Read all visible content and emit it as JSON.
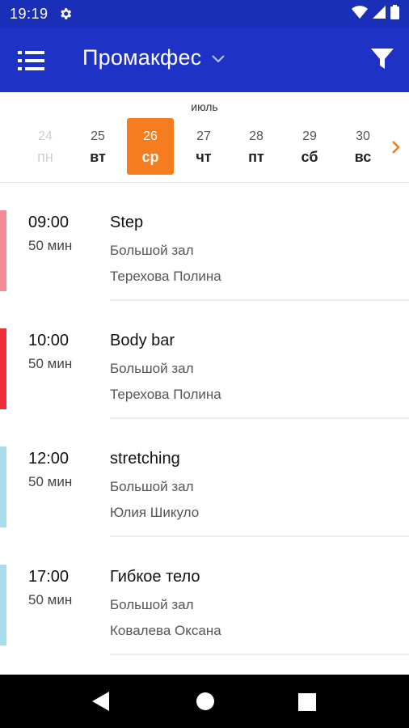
{
  "status": {
    "time": "19:19"
  },
  "appbar": {
    "title": "Промакфес",
    "colors": {
      "bar": "#1e33c6",
      "status": "#1a2fb8"
    }
  },
  "calendar": {
    "month": "июль",
    "accent": "#f57c1f",
    "days": [
      {
        "num": "24",
        "wd": "пн",
        "state": "disabled"
      },
      {
        "num": "25",
        "wd": "вт",
        "state": "normal"
      },
      {
        "num": "26",
        "wd": "ср",
        "state": "selected"
      },
      {
        "num": "27",
        "wd": "чт",
        "state": "normal"
      },
      {
        "num": "28",
        "wd": "пт",
        "state": "normal"
      },
      {
        "num": "29",
        "wd": "сб",
        "state": "normal"
      },
      {
        "num": "30",
        "wd": "вс",
        "state": "normal"
      }
    ]
  },
  "classes": [
    {
      "time": "09:00",
      "duration": "50 мин",
      "name": "Step",
      "hall": "Большой зал",
      "coach": "Терехова Полина",
      "color": "#f28b93"
    },
    {
      "time": "10:00",
      "duration": "50 мин",
      "name": "Body bar",
      "hall": "Большой зал",
      "coach": "Терехова Полина",
      "color": "#ef2f3c"
    },
    {
      "time": "12:00",
      "duration": "50 мин",
      "name": "stretching",
      "hall": "Большой зал",
      "coach": "Юлия Шикуло",
      "color": "#a6dcec"
    },
    {
      "time": "17:00",
      "duration": "50 мин",
      "name": "Гибкое тело",
      "hall": "Большой зал",
      "coach": "Ковалева Оксана",
      "color": "#a6dcec"
    }
  ],
  "icons": {
    "status": [
      "settings-gear-icon",
      "wifi-icon",
      "signal-icon",
      "battery-icon"
    ],
    "appbar": [
      "menu-icon",
      "chevron-down-icon",
      "filter-icon"
    ],
    "calendar": [
      "chevron-right-icon"
    ],
    "nav": [
      "back-icon",
      "home-icon",
      "recents-icon"
    ]
  }
}
